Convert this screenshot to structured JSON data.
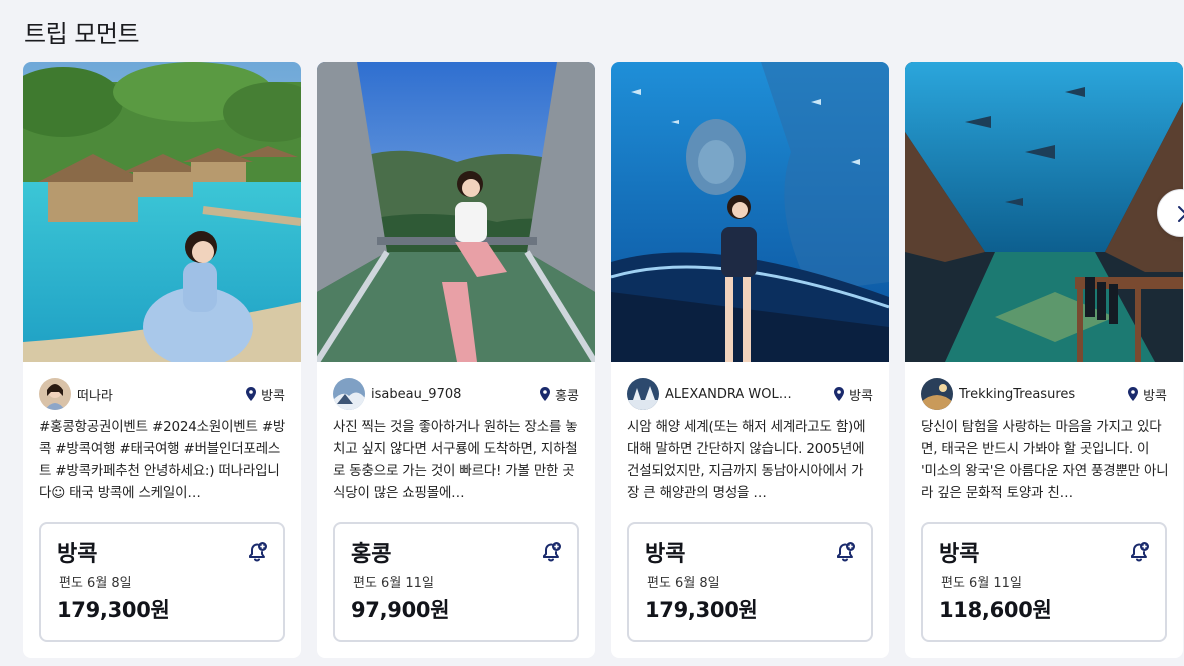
{
  "section": {
    "title": "트립 모먼트"
  },
  "cards": [
    {
      "author": "떠나라",
      "location": "방콕",
      "description": "#홍콩항공권이벤트 #2024소원이벤트 #방콕 #방콕여행 #태국여행 #버블인더포레스트 #방콕카페추천 안녕하세요:) 떠나라입니다☺ 태국 방콕에 스케일이…",
      "price_city": "방콕",
      "price_sub": "편도 6월 8일",
      "price_amount": "179,300원"
    },
    {
      "author": "isabeau_9708",
      "location": "홍콩",
      "description": "사진 찍는 것을 좋아하거나 원하는 장소를 놓치고 싶지 않다면 서구룡에 도착하면, 지하철로 동충으로 가는 것이 빠르다! 가볼 만한 곳 식당이 많은 쇼핑몰에…",
      "price_city": "홍콩",
      "price_sub": "편도 6월 11일",
      "price_amount": "97,900원"
    },
    {
      "author": "ALEXANDRA WOL…",
      "location": "방콕",
      "description": "시암 해양 세계(또는 해저 세계라고도 함)에 대해 말하면 간단하지 않습니다. 2005년에 건설되었지만, 지금까지 동남아시아에서 가장 큰 해양관의 명성을 …",
      "price_city": "방콕",
      "price_sub": "편도 6월 8일",
      "price_amount": "179,300원"
    },
    {
      "author": "TrekkingTreasures",
      "location": "방콕",
      "description": "당신이 탐험을 사랑하는 마음을 가지고 있다면, 태국은 반드시 가봐야 할 곳입니다. 이 '미소의 왕국'은 아름다운 자연 풍경뿐만 아니라 깊은 문화적 토양과 친…",
      "price_city": "방콕",
      "price_sub": "편도 6월 11일",
      "price_amount": "118,600원"
    }
  ],
  "icons": {
    "location": "map-pin-icon",
    "alert": "bell-plus-icon",
    "next": "chevron-right-icon"
  },
  "colors": {
    "accent": "#1a2a6c",
    "border": "#d8dbe3",
    "background": "#f2f3f7"
  }
}
